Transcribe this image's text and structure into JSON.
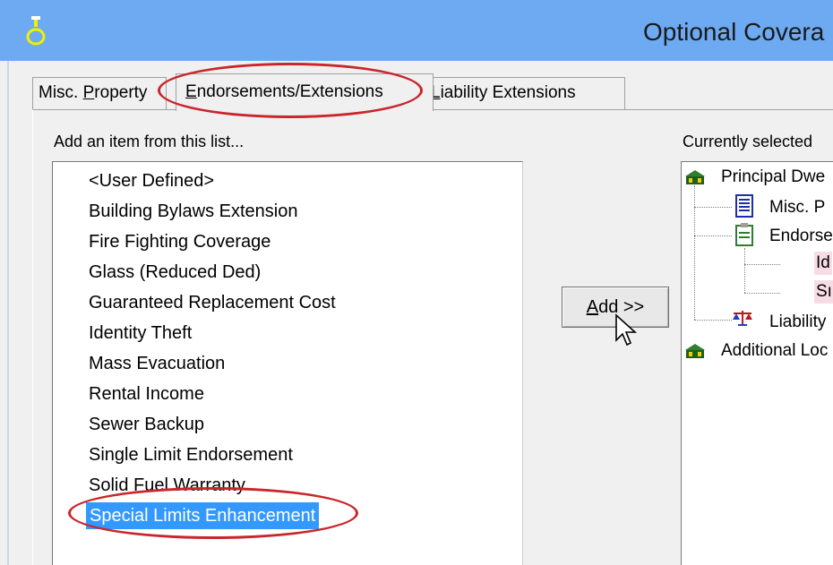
{
  "window": {
    "title": "Optional Covera"
  },
  "tabs": [
    {
      "label_pre": "Misc. ",
      "label_ul": "P",
      "label_post": "roperty"
    },
    {
      "label_pre": "",
      "label_ul": "E",
      "label_post": "ndorsements/Extensions"
    },
    {
      "label_pre": "",
      "label_ul": "L",
      "label_post": "iability Extensions"
    }
  ],
  "active_tab": "Endorsements/Extensions",
  "available": {
    "label": "Add an item from this list...",
    "items": [
      "<User Defined>",
      "Building Bylaws Extension",
      "Fire Fighting Coverage",
      "Glass (Reduced Ded)",
      "Guaranteed Replacement Cost",
      "Identity Theft",
      "Mass Evacuation",
      "Rental Income",
      "Sewer Backup",
      "Single Limit Endorsement",
      "Solid Fuel Warranty",
      "Special Limits Enhancement"
    ],
    "selected": "Special Limits Enhancement"
  },
  "add_button": {
    "label_ul": "A",
    "label_post": "dd >>"
  },
  "selected_tree": {
    "label": "Currently selected",
    "nodes": [
      {
        "text": "Principal Dwe",
        "icon": "house-icon"
      },
      {
        "text": "Misc. P",
        "icon": "document-icon"
      },
      {
        "text": "Endorse",
        "icon": "clipboard-icon"
      },
      {
        "text": "Id",
        "icon": ""
      },
      {
        "text": "Sı",
        "icon": ""
      },
      {
        "text": "Liability",
        "icon": "scales-icon"
      },
      {
        "text": "Additional Loc",
        "icon": "house-icon"
      }
    ]
  },
  "colors": {
    "titlebar": "#6daaf2",
    "selection": "#3399ff",
    "annotation_ring": "#c8262c",
    "tree_highlight": "#f7dce6"
  }
}
